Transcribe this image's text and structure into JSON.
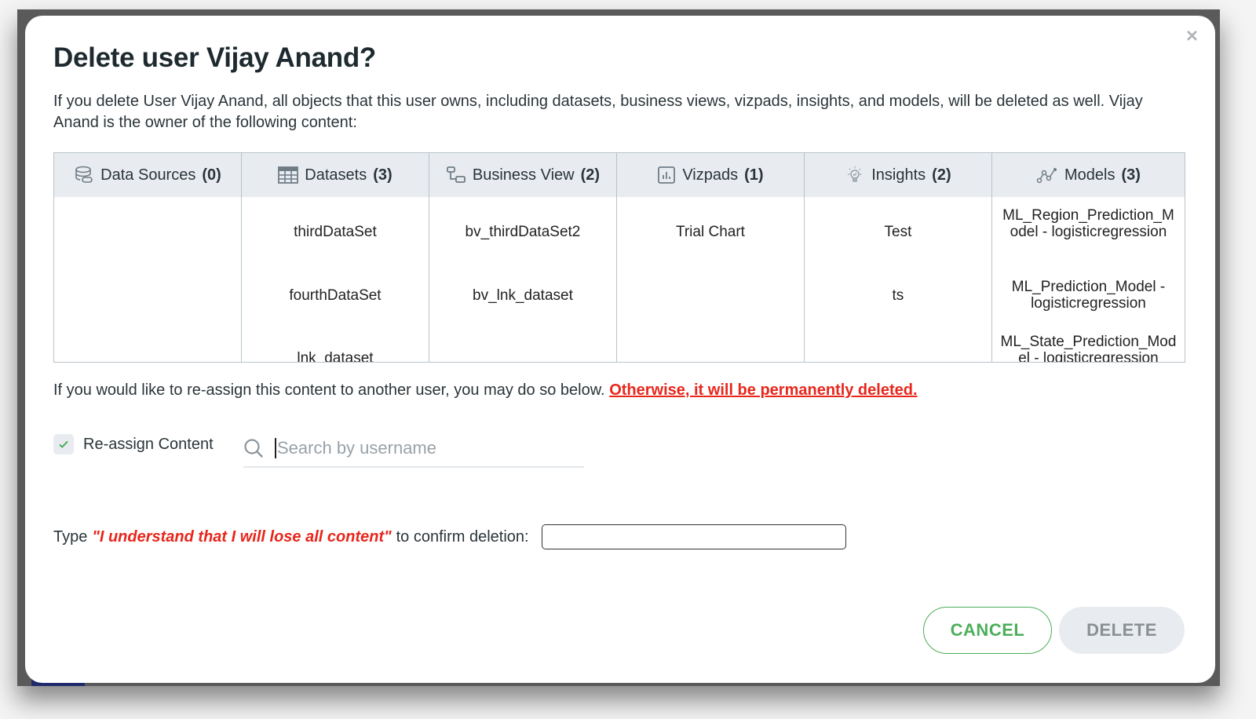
{
  "dialog": {
    "title": "Delete user Vijay Anand?",
    "description": "If you delete User Vijay Anand, all objects that this user owns, including datasets, business views, vizpads, insights, and models, will be deleted as well. Vijay Anand is the owner of the following content:",
    "close_icon": "×"
  },
  "content_table": {
    "columns": [
      {
        "label": "Data Sources",
        "count": "(0)",
        "icon": "data-source-icon",
        "items": []
      },
      {
        "label": "Datasets",
        "count": "(3)",
        "icon": "table-grid-icon",
        "items": [
          "thirdDataSet",
          "fourthDataSet",
          "lnk_dataset"
        ]
      },
      {
        "label": "Business View",
        "count": "(2)",
        "icon": "business-view-icon",
        "items": [
          "bv_thirdDataSet2",
          "bv_lnk_dataset"
        ]
      },
      {
        "label": "Vizpads",
        "count": "(1)",
        "icon": "bar-chart-icon",
        "items": [
          "Trial Chart"
        ]
      },
      {
        "label": "Insights",
        "count": "(2)",
        "icon": "lightbulb-icon",
        "items": [
          "Test",
          "ts"
        ]
      },
      {
        "label": "Models",
        "count": "(3)",
        "icon": "model-graph-icon",
        "items": [
          "ML_Region_Prediction_Model - logisticregression",
          "ML_Prediction_Model - logisticregression",
          "ML_State_Prediction_Model - logisticregression"
        ]
      }
    ]
  },
  "reassign": {
    "notice_text": "If you would like to re-assign this content to another user, you may do so below. ",
    "warning_link": "Otherwise, it will be permanently deleted.",
    "checkbox_label": "Re-assign Content",
    "checkbox_checked": true,
    "search_placeholder": "Search by username",
    "search_value": ""
  },
  "confirm": {
    "prefix": "Type",
    "phrase": "\"I understand that I will lose all content\"",
    "suffix": "to confirm deletion:",
    "value": ""
  },
  "buttons": {
    "cancel": "CANCEL",
    "delete": "DELETE"
  },
  "colors": {
    "accent_green": "#4cae5a",
    "danger_red": "#e8261c",
    "header_bg": "#e8ecf0"
  }
}
